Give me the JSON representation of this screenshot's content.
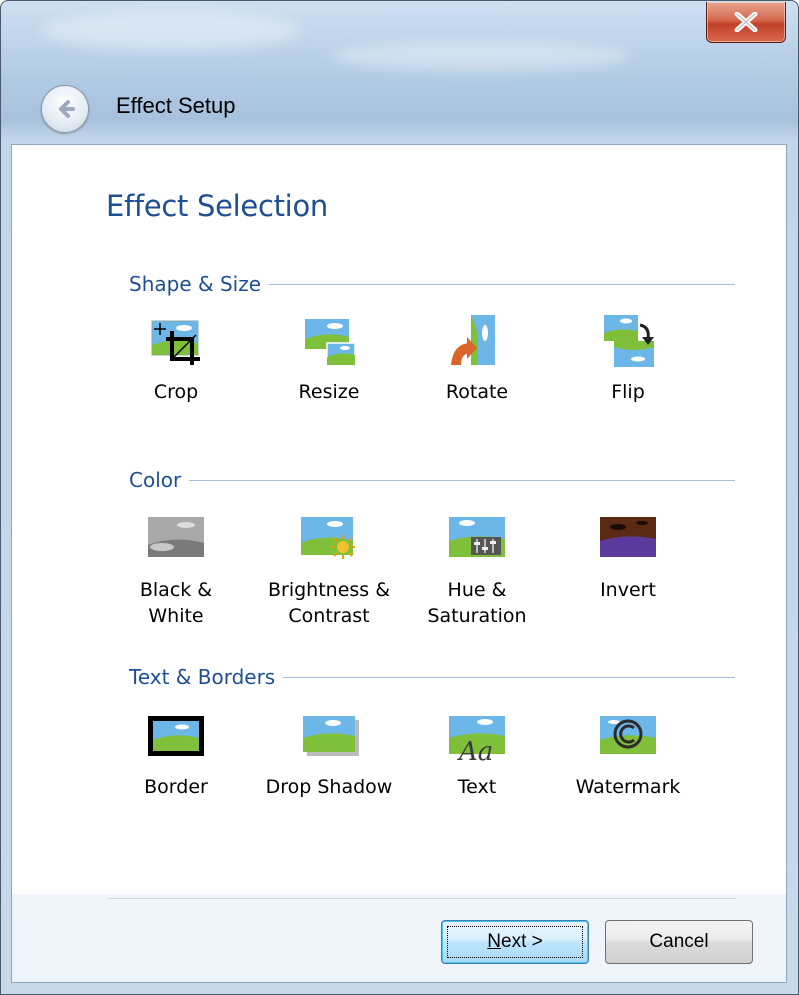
{
  "window": {
    "title": "Effect Setup"
  },
  "titlebar": {
    "close_icon": "close-x-icon",
    "back_icon": "back-arrow-icon"
  },
  "page": {
    "title": "Effect Selection"
  },
  "sections": [
    {
      "title": "Shape & Size",
      "items": [
        {
          "label": "Crop",
          "icon": "crop-icon"
        },
        {
          "label": "Resize",
          "icon": "resize-icon"
        },
        {
          "label": "Rotate",
          "icon": "rotate-icon"
        },
        {
          "label": "Flip",
          "icon": "flip-icon"
        }
      ]
    },
    {
      "title": "Color",
      "items": [
        {
          "label": "Black & White",
          "icon": "black-white-icon"
        },
        {
          "label": "Brightness &\nContrast",
          "icon": "brightness-contrast-icon"
        },
        {
          "label": "Hue &\nSaturation",
          "icon": "hue-saturation-icon"
        },
        {
          "label": "Invert",
          "icon": "invert-icon"
        }
      ]
    },
    {
      "title": "Text & Borders",
      "items": [
        {
          "label": "Border",
          "icon": "border-icon"
        },
        {
          "label": "Drop Shadow",
          "icon": "drop-shadow-icon"
        },
        {
          "label": "Text",
          "icon": "text-icon"
        },
        {
          "label": "Watermark",
          "icon": "watermark-icon"
        }
      ]
    }
  ],
  "buttons": {
    "next_mnemonic": "N",
    "next_rest": "ext >",
    "cancel": "Cancel"
  },
  "colors": {
    "accent": "#1e4f94",
    "close": "#c2402a",
    "sky": "#6cb6e8",
    "grass": "#7fbf3a"
  }
}
